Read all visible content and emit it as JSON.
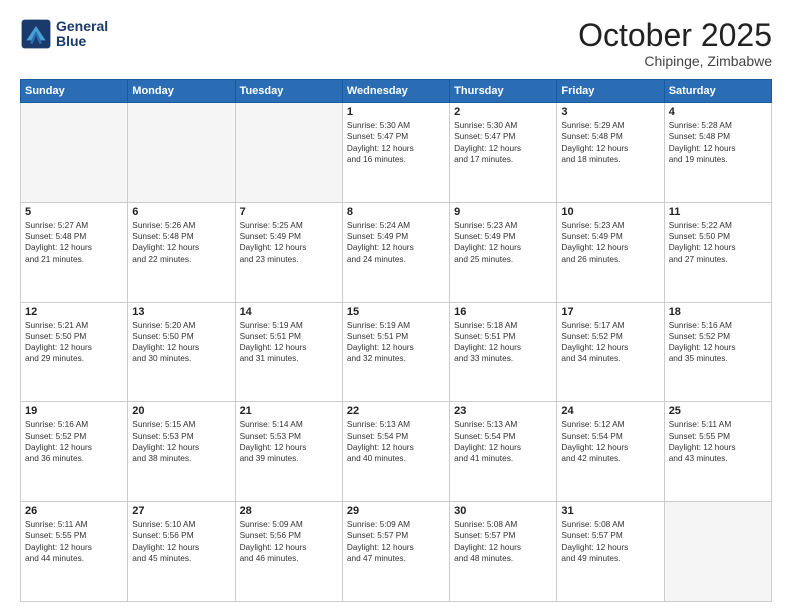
{
  "logo": {
    "line1": "General",
    "line2": "Blue"
  },
  "title": "October 2025",
  "subtitle": "Chipinge, Zimbabwe",
  "weekdays": [
    "Sunday",
    "Monday",
    "Tuesday",
    "Wednesday",
    "Thursday",
    "Friday",
    "Saturday"
  ],
  "weeks": [
    [
      {
        "day": "",
        "info": ""
      },
      {
        "day": "",
        "info": ""
      },
      {
        "day": "",
        "info": ""
      },
      {
        "day": "1",
        "info": "Sunrise: 5:30 AM\nSunset: 5:47 PM\nDaylight: 12 hours\nand 16 minutes."
      },
      {
        "day": "2",
        "info": "Sunrise: 5:30 AM\nSunset: 5:47 PM\nDaylight: 12 hours\nand 17 minutes."
      },
      {
        "day": "3",
        "info": "Sunrise: 5:29 AM\nSunset: 5:48 PM\nDaylight: 12 hours\nand 18 minutes."
      },
      {
        "day": "4",
        "info": "Sunrise: 5:28 AM\nSunset: 5:48 PM\nDaylight: 12 hours\nand 19 minutes."
      }
    ],
    [
      {
        "day": "5",
        "info": "Sunrise: 5:27 AM\nSunset: 5:48 PM\nDaylight: 12 hours\nand 21 minutes."
      },
      {
        "day": "6",
        "info": "Sunrise: 5:26 AM\nSunset: 5:48 PM\nDaylight: 12 hours\nand 22 minutes."
      },
      {
        "day": "7",
        "info": "Sunrise: 5:25 AM\nSunset: 5:49 PM\nDaylight: 12 hours\nand 23 minutes."
      },
      {
        "day": "8",
        "info": "Sunrise: 5:24 AM\nSunset: 5:49 PM\nDaylight: 12 hours\nand 24 minutes."
      },
      {
        "day": "9",
        "info": "Sunrise: 5:23 AM\nSunset: 5:49 PM\nDaylight: 12 hours\nand 25 minutes."
      },
      {
        "day": "10",
        "info": "Sunrise: 5:23 AM\nSunset: 5:49 PM\nDaylight: 12 hours\nand 26 minutes."
      },
      {
        "day": "11",
        "info": "Sunrise: 5:22 AM\nSunset: 5:50 PM\nDaylight: 12 hours\nand 27 minutes."
      }
    ],
    [
      {
        "day": "12",
        "info": "Sunrise: 5:21 AM\nSunset: 5:50 PM\nDaylight: 12 hours\nand 29 minutes."
      },
      {
        "day": "13",
        "info": "Sunrise: 5:20 AM\nSunset: 5:50 PM\nDaylight: 12 hours\nand 30 minutes."
      },
      {
        "day": "14",
        "info": "Sunrise: 5:19 AM\nSunset: 5:51 PM\nDaylight: 12 hours\nand 31 minutes."
      },
      {
        "day": "15",
        "info": "Sunrise: 5:19 AM\nSunset: 5:51 PM\nDaylight: 12 hours\nand 32 minutes."
      },
      {
        "day": "16",
        "info": "Sunrise: 5:18 AM\nSunset: 5:51 PM\nDaylight: 12 hours\nand 33 minutes."
      },
      {
        "day": "17",
        "info": "Sunrise: 5:17 AM\nSunset: 5:52 PM\nDaylight: 12 hours\nand 34 minutes."
      },
      {
        "day": "18",
        "info": "Sunrise: 5:16 AM\nSunset: 5:52 PM\nDaylight: 12 hours\nand 35 minutes."
      }
    ],
    [
      {
        "day": "19",
        "info": "Sunrise: 5:16 AM\nSunset: 5:52 PM\nDaylight: 12 hours\nand 36 minutes."
      },
      {
        "day": "20",
        "info": "Sunrise: 5:15 AM\nSunset: 5:53 PM\nDaylight: 12 hours\nand 38 minutes."
      },
      {
        "day": "21",
        "info": "Sunrise: 5:14 AM\nSunset: 5:53 PM\nDaylight: 12 hours\nand 39 minutes."
      },
      {
        "day": "22",
        "info": "Sunrise: 5:13 AM\nSunset: 5:54 PM\nDaylight: 12 hours\nand 40 minutes."
      },
      {
        "day": "23",
        "info": "Sunrise: 5:13 AM\nSunset: 5:54 PM\nDaylight: 12 hours\nand 41 minutes."
      },
      {
        "day": "24",
        "info": "Sunrise: 5:12 AM\nSunset: 5:54 PM\nDaylight: 12 hours\nand 42 minutes."
      },
      {
        "day": "25",
        "info": "Sunrise: 5:11 AM\nSunset: 5:55 PM\nDaylight: 12 hours\nand 43 minutes."
      }
    ],
    [
      {
        "day": "26",
        "info": "Sunrise: 5:11 AM\nSunset: 5:55 PM\nDaylight: 12 hours\nand 44 minutes."
      },
      {
        "day": "27",
        "info": "Sunrise: 5:10 AM\nSunset: 5:56 PM\nDaylight: 12 hours\nand 45 minutes."
      },
      {
        "day": "28",
        "info": "Sunrise: 5:09 AM\nSunset: 5:56 PM\nDaylight: 12 hours\nand 46 minutes."
      },
      {
        "day": "29",
        "info": "Sunrise: 5:09 AM\nSunset: 5:57 PM\nDaylight: 12 hours\nand 47 minutes."
      },
      {
        "day": "30",
        "info": "Sunrise: 5:08 AM\nSunset: 5:57 PM\nDaylight: 12 hours\nand 48 minutes."
      },
      {
        "day": "31",
        "info": "Sunrise: 5:08 AM\nSunset: 5:57 PM\nDaylight: 12 hours\nand 49 minutes."
      },
      {
        "day": "",
        "info": ""
      }
    ]
  ]
}
